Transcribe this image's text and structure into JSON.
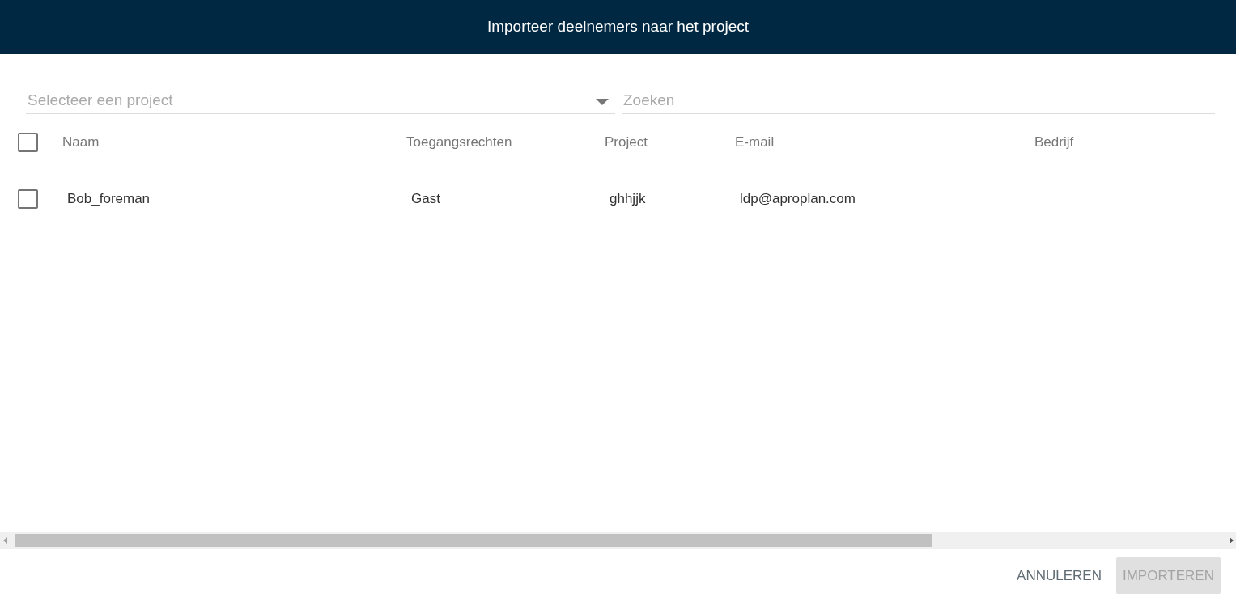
{
  "window": {
    "title": "Importeer deelnemers naar het project"
  },
  "project_select": {
    "placeholder": "Selecteer een project"
  },
  "search": {
    "placeholder": "Zoeken"
  },
  "table": {
    "select_all_checked": false,
    "columns": [
      "Naam",
      "Toegangsrechten",
      "Project",
      "E-mail",
      "Bedrijf"
    ],
    "rows": [
      {
        "checked": false,
        "cells": [
          "Bob_foreman",
          "Gast",
          "ghhjjk",
          "ldp@aproplan.com",
          ""
        ]
      }
    ]
  },
  "buttons": [
    {
      "label": "ANNULEREN",
      "kind": "text",
      "disabled": false
    },
    {
      "label": "IMPORTEREN",
      "kind": "filled",
      "disabled": true
    }
  ]
}
